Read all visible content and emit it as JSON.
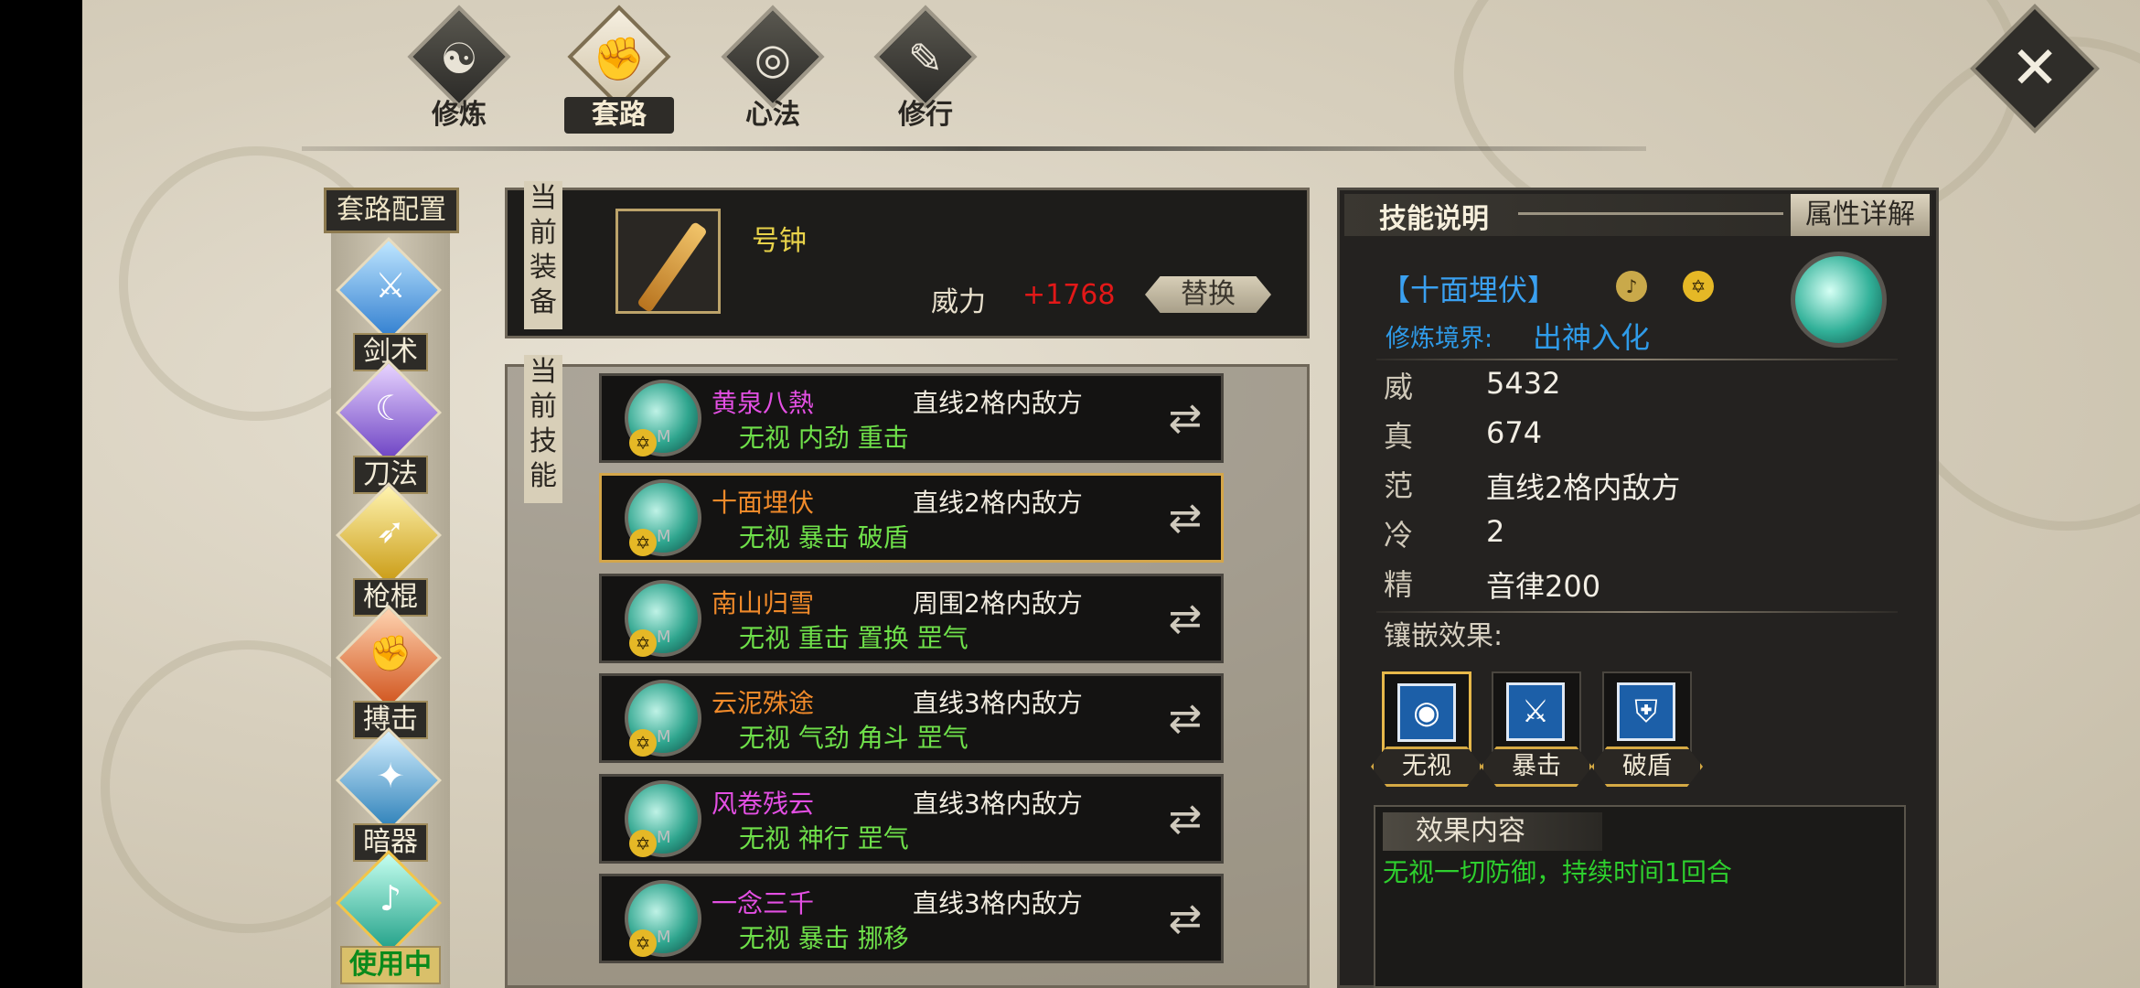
{
  "top_tabs": [
    {
      "label": "修炼",
      "glyph": "☯",
      "active": false
    },
    {
      "label": "套路",
      "glyph": "✊",
      "active": true
    },
    {
      "label": "心法",
      "glyph": "◎",
      "active": false
    },
    {
      "label": "修行",
      "glyph": "✎",
      "active": false
    }
  ],
  "close_glyph": "✕",
  "sidebar": {
    "title": "套路配置",
    "categories": [
      {
        "label": "剑术",
        "glyph": "⚔"
      },
      {
        "label": "刀法",
        "glyph": "☾"
      },
      {
        "label": "枪棍",
        "glyph": "➶"
      },
      {
        "label": "搏击",
        "glyph": "✊"
      },
      {
        "label": "暗器",
        "glyph": "✦"
      },
      {
        "label": "使用中",
        "glyph": "♪"
      }
    ]
  },
  "equipment": {
    "section_label": [
      "当",
      "前",
      "装",
      "备"
    ],
    "name": "号钟",
    "power_label": "威力",
    "power_value": "+1768",
    "replace_label": "替换"
  },
  "skills": {
    "section_label": [
      "当",
      "前",
      "技",
      "能"
    ],
    "badge_glyph": "✡",
    "badge_num": "M",
    "swap_glyph": "⇄",
    "items": [
      {
        "name": "黄泉八熱",
        "range": "直线2格内敌方",
        "tags": "无视 内劲 重击",
        "name_color": "#e34fe3",
        "selected": false
      },
      {
        "name": "十面埋伏",
        "range": "直线2格内敌方",
        "tags": "无视 暴击 破盾",
        "name_color": "#f08a2a",
        "selected": true
      },
      {
        "name": "南山归雪",
        "range": "周围2格内敌方",
        "tags": "无视 重击 置换 罡气",
        "name_color": "#f08a2a",
        "selected": false
      },
      {
        "name": "云泥殊途",
        "range": "直线3格内敌方",
        "tags": "无视 气劲 角斗 罡气",
        "name_color": "#f08a2a",
        "selected": false
      },
      {
        "name": "风卷残云",
        "range": "直线3格内敌方",
        "tags": "无视 神行 罡气",
        "name_color": "#e34fe3",
        "selected": false
      },
      {
        "name": "一念三千",
        "range": "直线3格内敌方",
        "tags": "无视 暴击 挪移",
        "name_color": "#e34fe3",
        "selected": false
      }
    ]
  },
  "detail": {
    "title": "技能说明",
    "attr_button": "属性详解",
    "skill_name": "【十面埋伏】",
    "realm_label": "修炼境界:",
    "realm_value": "出神入化",
    "stats": [
      {
        "key": "威",
        "value": "5432"
      },
      {
        "key": "真",
        "value": "674"
      },
      {
        "key": "范",
        "value": "直线2格内敌方"
      },
      {
        "key": "冷",
        "value": "2"
      },
      {
        "key": "精",
        "value": "音律200"
      }
    ],
    "embed_label": "镶嵌效果:",
    "gems": [
      {
        "label": "无视",
        "glyph": "◉",
        "selected": true
      },
      {
        "label": "暴击",
        "glyph": "⚔",
        "selected": false
      },
      {
        "label": "破盾",
        "glyph": "⛨",
        "selected": false
      }
    ],
    "effect_header": "效果内容",
    "effect_text": "无视一切防御，持续时间1回合"
  }
}
